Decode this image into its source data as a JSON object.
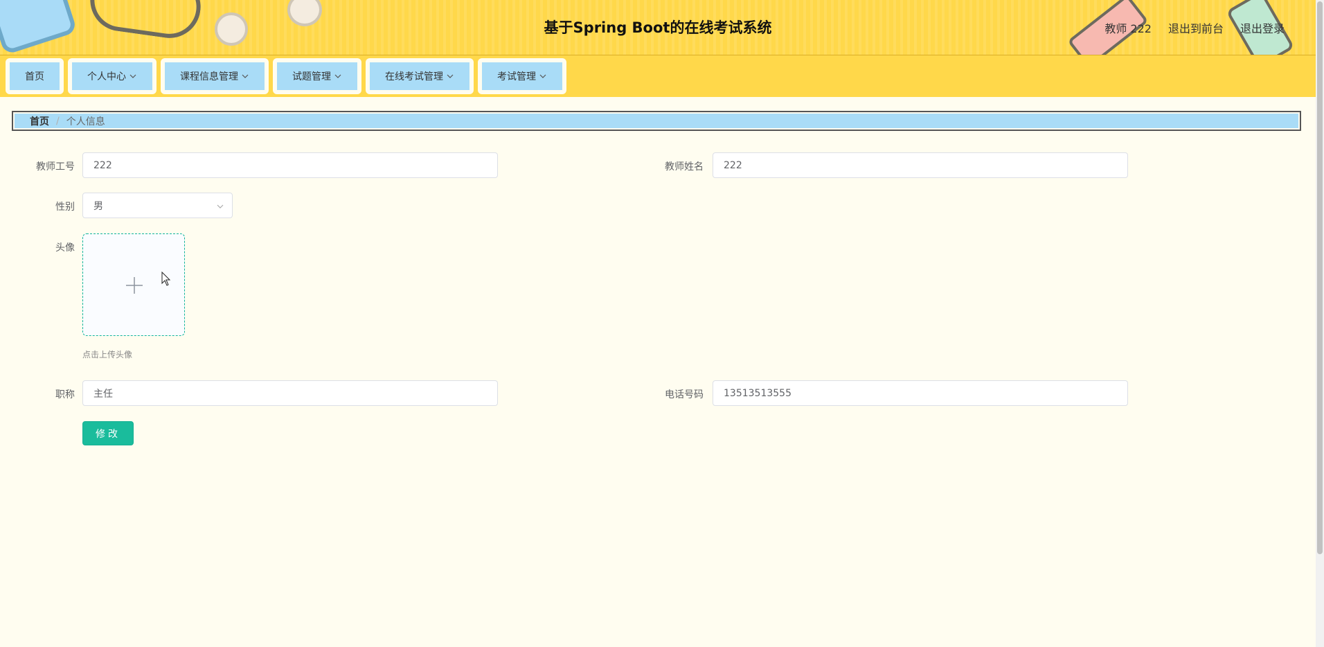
{
  "header": {
    "title": "基于Spring Boot的在线考试系统",
    "user_label": "教师 222",
    "back_front_label": "退出到前台",
    "logout_label": "退出登录"
  },
  "nav": {
    "items": [
      {
        "label": "首页",
        "has_dropdown": false
      },
      {
        "label": "个人中心",
        "has_dropdown": true
      },
      {
        "label": "课程信息管理",
        "has_dropdown": true
      },
      {
        "label": "试题管理",
        "has_dropdown": true
      },
      {
        "label": "在线考试管理",
        "has_dropdown": true
      },
      {
        "label": "考试管理",
        "has_dropdown": true
      }
    ]
  },
  "breadcrumb": {
    "home": "首页",
    "separator": "/",
    "current": "个人信息"
  },
  "form": {
    "teacher_id_label": "教师工号",
    "teacher_id_value": "222",
    "teacher_name_label": "教师姓名",
    "teacher_name_value": "222",
    "gender_label": "性别",
    "gender_value": "男",
    "avatar_label": "头像",
    "upload_tip": "点击上传头像",
    "title_label": "职称",
    "title_value": "主任",
    "phone_label": "电话号码",
    "phone_value": "13513513555",
    "submit_label": "修改"
  },
  "colors": {
    "header_bg": "#ffd84a",
    "nav_item_bg": "#a9dcf7",
    "page_bg": "#fffdf0",
    "submit_bg": "#1abc9c"
  }
}
